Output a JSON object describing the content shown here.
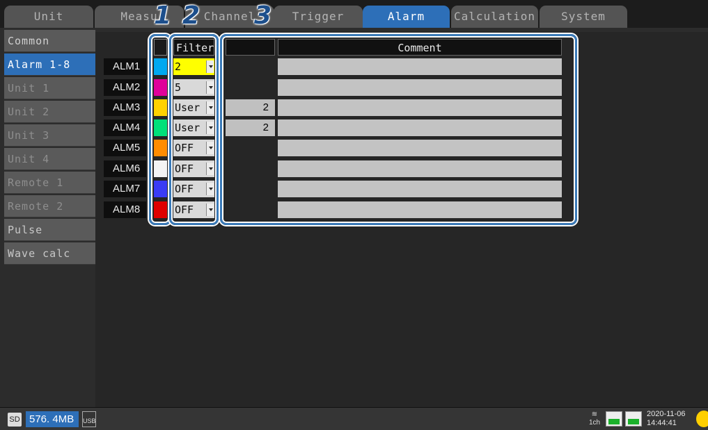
{
  "tabs": [
    {
      "label": "Unit"
    },
    {
      "label": "Measu"
    },
    {
      "label": "Channel"
    },
    {
      "label": "Trigger"
    },
    {
      "label": "Alarm"
    },
    {
      "label": "Calculation"
    },
    {
      "label": "System"
    }
  ],
  "active_tab": "Alarm",
  "sidebar": {
    "items": [
      {
        "label": "Common"
      },
      {
        "label": "Alarm 1-8"
      },
      {
        "label": "Unit 1"
      },
      {
        "label": "Unit 2"
      },
      {
        "label": "Unit 3"
      },
      {
        "label": "Unit 4"
      },
      {
        "label": "Remote 1"
      },
      {
        "label": "Remote 2"
      },
      {
        "label": "Pulse"
      },
      {
        "label": "Wave calc"
      }
    ],
    "active": "Alarm 1-8"
  },
  "table": {
    "filter_header": "Filter",
    "comment_header": "Comment",
    "rows": [
      {
        "name": "ALM1",
        "color": "#00a8f0",
        "filter": "2",
        "value": "",
        "highlight": true
      },
      {
        "name": "ALM2",
        "color": "#e0009a",
        "filter": "5",
        "value": ""
      },
      {
        "name": "ALM3",
        "color": "#ffd200",
        "filter": "User",
        "value": "2"
      },
      {
        "name": "ALM4",
        "color": "#00e07a",
        "filter": "User",
        "value": "2"
      },
      {
        "name": "ALM5",
        "color": "#ff8c00",
        "filter": "OFF",
        "value": ""
      },
      {
        "name": "ALM6",
        "color": "#f4f4f4",
        "filter": "OFF",
        "value": ""
      },
      {
        "name": "ALM7",
        "color": "#3a3cf5",
        "filter": "OFF",
        "value": ""
      },
      {
        "name": "ALM8",
        "color": "#e00000",
        "filter": "OFF",
        "value": ""
      }
    ]
  },
  "callouts": [
    "1",
    "2",
    "3"
  ],
  "status": {
    "storage_label": "SD",
    "memory": "576. 4MB",
    "usb_label": "USB",
    "channel_label": "1ch",
    "date": "2020-11-06",
    "time": "14:44:41"
  }
}
